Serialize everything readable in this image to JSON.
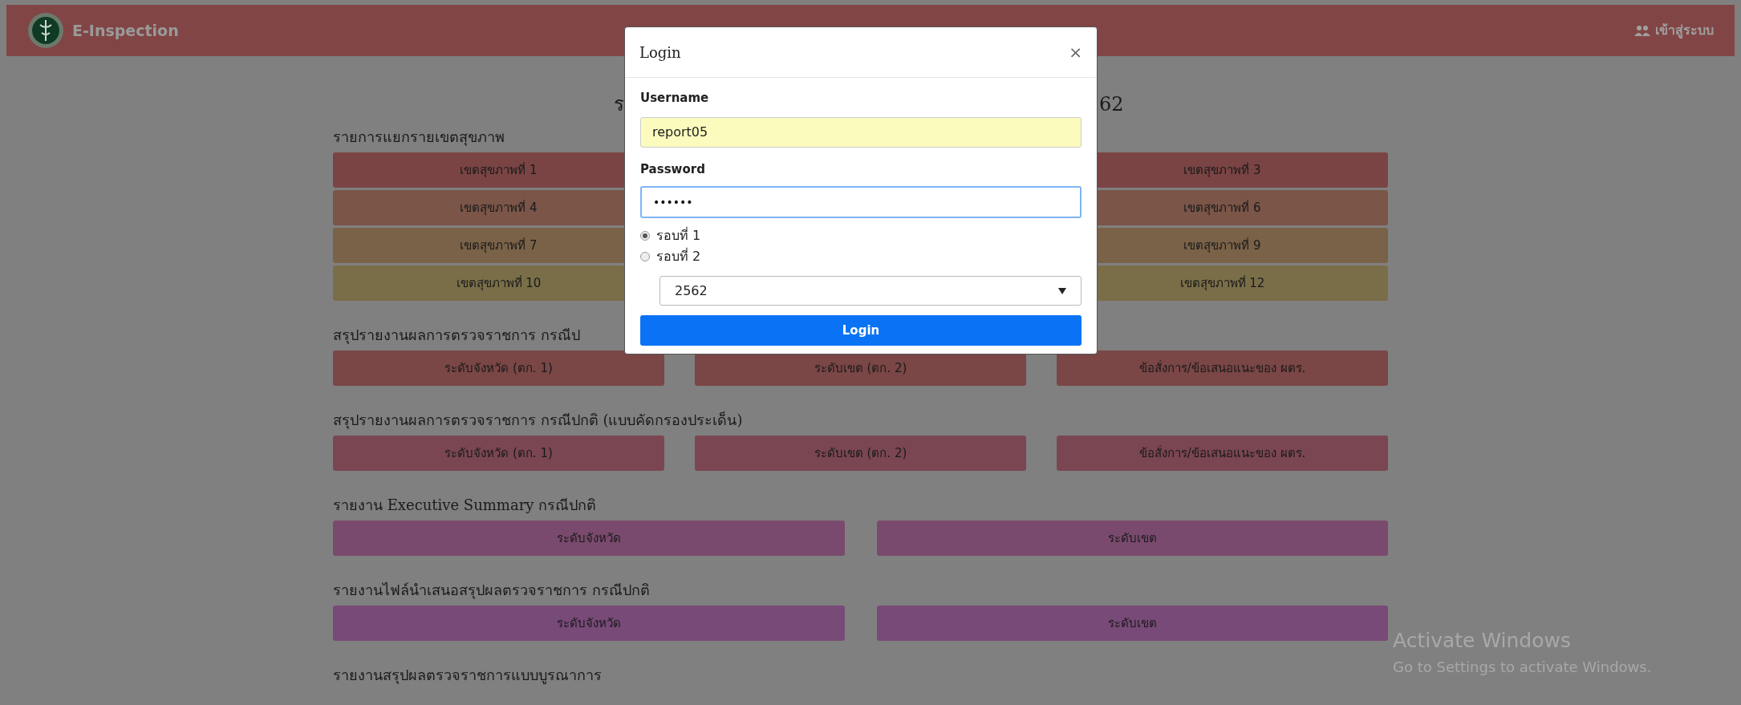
{
  "header": {
    "brand": "E-Inspection",
    "login_link": "เข้าสู่ระบบ"
  },
  "page_title": {
    "left_fragment": "ร",
    "right_fragment": "62"
  },
  "sections": [
    {
      "heading": "รายการแยกรายเขตสุขภาพ",
      "buttons": [
        {
          "kind": "button",
          "label": "เขตสุขภาพที่ 1"
        },
        {
          "kind": "covered"
        },
        {
          "kind": "button",
          "label": "เขตสุขภาพที่ 3"
        },
        {
          "kind": "button",
          "label": "เขตสุขภาพที่ 4"
        },
        {
          "kind": "covered"
        },
        {
          "kind": "button",
          "label": "เขตสุขภาพที่ 6"
        },
        {
          "kind": "button",
          "label": "เขตสุขภาพที่ 7"
        },
        {
          "kind": "covered"
        },
        {
          "kind": "button",
          "label": "เขตสุขภาพที่ 9"
        },
        {
          "kind": "button",
          "label": "เขตสุขภาพที่ 10"
        },
        {
          "kind": "covered"
        },
        {
          "kind": "button",
          "label": "เขตสุขภาพที่ 12"
        }
      ]
    },
    {
      "heading": "สรุปรายงานผลการตรวจราชการ กรณีป",
      "buttons": [
        {
          "kind": "button",
          "label": "ระดับจังหวัด (ตก. 1)"
        },
        {
          "kind": "button",
          "label": "ระดับเขต (ตก. 2)"
        },
        {
          "kind": "button",
          "label": "ข้อสั่งการ/ข้อเสนอแนะของ ผตร."
        }
      ]
    },
    {
      "heading": "สรุปรายงานผลการตรวจราชการ กรณีปกติ (แบบคัดกรองประเด็น)",
      "buttons": [
        {
          "kind": "button",
          "label": "ระดับจังหวัด (ตก. 1)"
        },
        {
          "kind": "button",
          "label": "ระดับเขต (ตก. 2)"
        },
        {
          "kind": "button",
          "label": "ข้อสั่งการ/ข้อเสนอแนะของ ผตร."
        }
      ]
    },
    {
      "heading": "รายงาน Executive Summary กรณีปกติ",
      "buttons": [
        {
          "kind": "button",
          "label": "ระดับจังหวัด"
        },
        {
          "kind": "button",
          "label": "ระดับเขต"
        }
      ]
    },
    {
      "heading": "รายงานไฟล์นำเสนอสรุปผลตรวจราชการ กรณีปกติ",
      "buttons": [
        {
          "kind": "button",
          "label": "ระดับจังหวัด"
        },
        {
          "kind": "button",
          "label": "ระดับเขต"
        }
      ]
    },
    {
      "heading": "รายงานสรุปผลตรวจราชการแบบบูรณาการ"
    }
  ],
  "modal": {
    "title": "Login",
    "close": "×",
    "username_label": "Username",
    "username_value": "report05",
    "password_label": "Password",
    "password_value": "••••••",
    "rounds": [
      {
        "label": "รอบที่ 1",
        "selected": true
      },
      {
        "label": "รอบที่ 2",
        "selected": false
      }
    ],
    "year": "2562",
    "submit": "Login"
  },
  "os_notice": {
    "title": "Activate Windows",
    "subtitle": "Go to Settings to activate Windows."
  }
}
